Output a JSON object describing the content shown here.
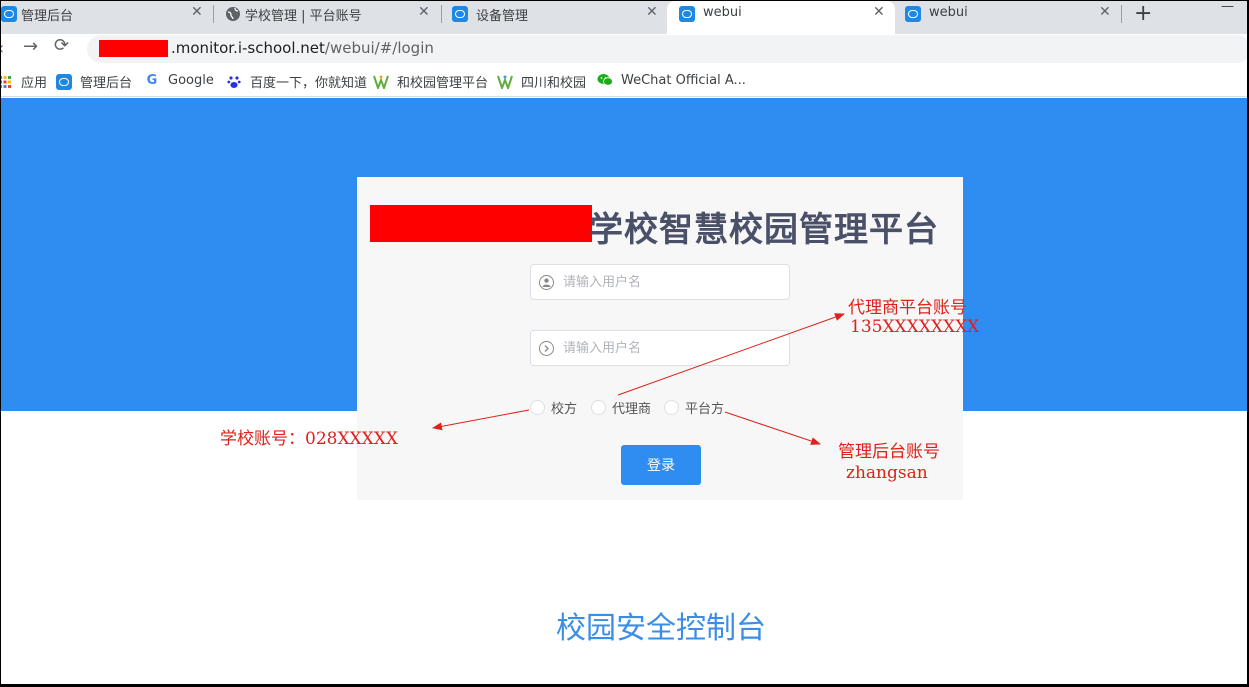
{
  "browser": {
    "tabs": [
      {
        "title": "管理后台",
        "icon": "app-favicon-icon"
      },
      {
        "title": "学校管理 | 平台账号",
        "icon": "globe-icon"
      },
      {
        "title": "设备管理",
        "icon": "app-favicon-icon"
      },
      {
        "title": "webui",
        "icon": "app-favicon-icon",
        "active": true
      },
      {
        "title": "webui",
        "icon": "app-favicon-icon"
      }
    ],
    "new_tab": "+",
    "close_glyph": "✕",
    "minimize_glyph": "—",
    "url_domain": ".monitor.i-school.net",
    "url_path": "/webui/#/login",
    "bookmarks": [
      {
        "label": "应用",
        "icon": "apps-grid-icon"
      },
      {
        "label": "管理后台",
        "icon": "app-favicon-icon"
      },
      {
        "label": "Google",
        "icon": "google-icon"
      },
      {
        "label": "百度一下，你就知道",
        "icon": "baidu-paw-icon"
      },
      {
        "label": "和校园管理平台",
        "icon": "hexiaoyuan-icon"
      },
      {
        "label": "四川和校园",
        "icon": "hexiaoyuan-icon"
      },
      {
        "label": "WeChat Official A...",
        "icon": "wechat-icon"
      }
    ]
  },
  "login": {
    "title": "学校智慧校园管理平台",
    "username_placeholder": "请输入用户名",
    "password_placeholder": "请输入用户名",
    "roles": [
      "校方",
      "代理商",
      "平台方"
    ],
    "submit": "登录"
  },
  "footer_title": "校园安全控制台",
  "annotations": {
    "school": "学校账号：028XXXXX",
    "agent_title": "代理商平台账号",
    "agent_value": "135XXXXXXXX",
    "admin_title": "管理后台账号",
    "admin_value": "zhangsan"
  },
  "colors": {
    "hero_blue": "#2f8cf0",
    "annotation_red": "#e0201b",
    "redaction_red": "#ff0000",
    "title_text": "#4a5068"
  }
}
